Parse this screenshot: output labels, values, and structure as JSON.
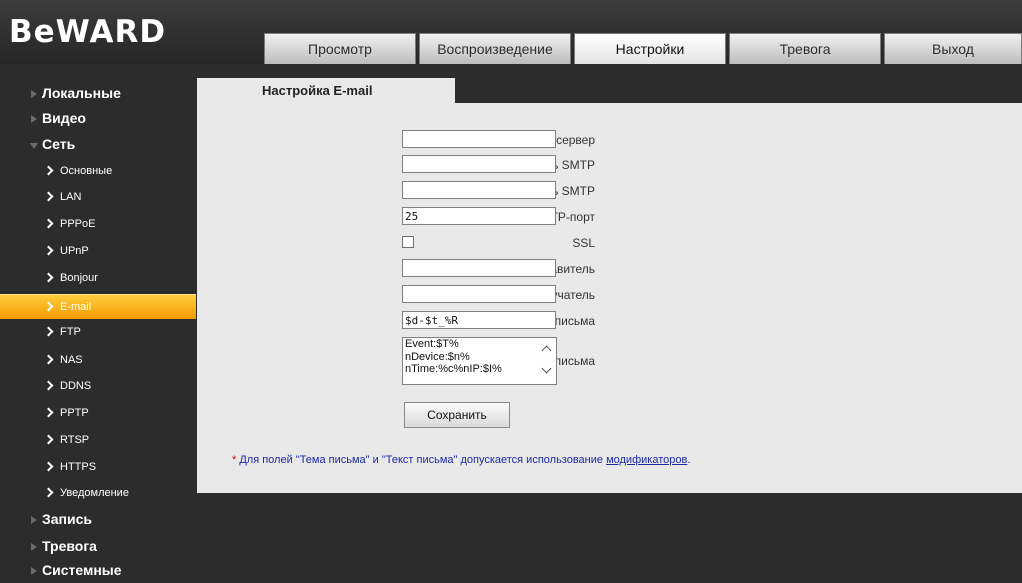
{
  "header": {
    "logo_text": "BeWARD",
    "tabs": [
      {
        "label": "Просмотр"
      },
      {
        "label": "Воспроизведение"
      },
      {
        "label": "Настройки",
        "active": true
      },
      {
        "label": "Тревога"
      },
      {
        "label": "Выход"
      }
    ]
  },
  "sidebar": {
    "top_items": [
      "Локальные",
      "Видео",
      "Сеть",
      "Запись",
      "Тревога",
      "Системные"
    ],
    "network_sub_items": [
      "Основные",
      "LAN",
      "PPPoE",
      "UPnP",
      "Bonjour",
      "E-mail",
      "FTP",
      "NAS",
      "DDNS",
      "PPTP",
      "RTSP",
      "HTTPS",
      "Уведомление"
    ],
    "active_sub_item": "E-mail"
  },
  "content": {
    "tab_title": "Настройка E-mail",
    "fields": {
      "smtp_server": {
        "label": "SMTP-сервер",
        "value": ""
      },
      "smtp_user": {
        "label": "Пользователь SMTP",
        "value": ""
      },
      "smtp_password": {
        "label": "Пароль SMTP",
        "value": ""
      },
      "smtp_port": {
        "label": "SMTP-порт",
        "value": "25"
      },
      "ssl": {
        "label": "SSL",
        "checked": false
      },
      "sender": {
        "label": "Отправитель",
        "value": ""
      },
      "recipient": {
        "label": "Получатель",
        "value": ""
      },
      "subject": {
        "label": "Тема письма",
        "value": "$d-$t_%R"
      },
      "body": {
        "label": "Текст письма",
        "lines": [
          "Event:$T%",
          "nDevice:$n%",
          "nTime:%c%nIP:$I%"
        ]
      }
    },
    "save_label": "Сохранить",
    "note": {
      "asterisk": "*",
      "text": "Для полей \"Тема письма\" и \"Текст письма\" допускается использование",
      "link": "модификаторов",
      "period": "."
    }
  },
  "colors": {
    "background": "#2c2c2c",
    "content_bg": "#e9e9e9",
    "active_item": "#f29a00",
    "link": "#1a2aa0",
    "asterisk": "#d40000"
  }
}
